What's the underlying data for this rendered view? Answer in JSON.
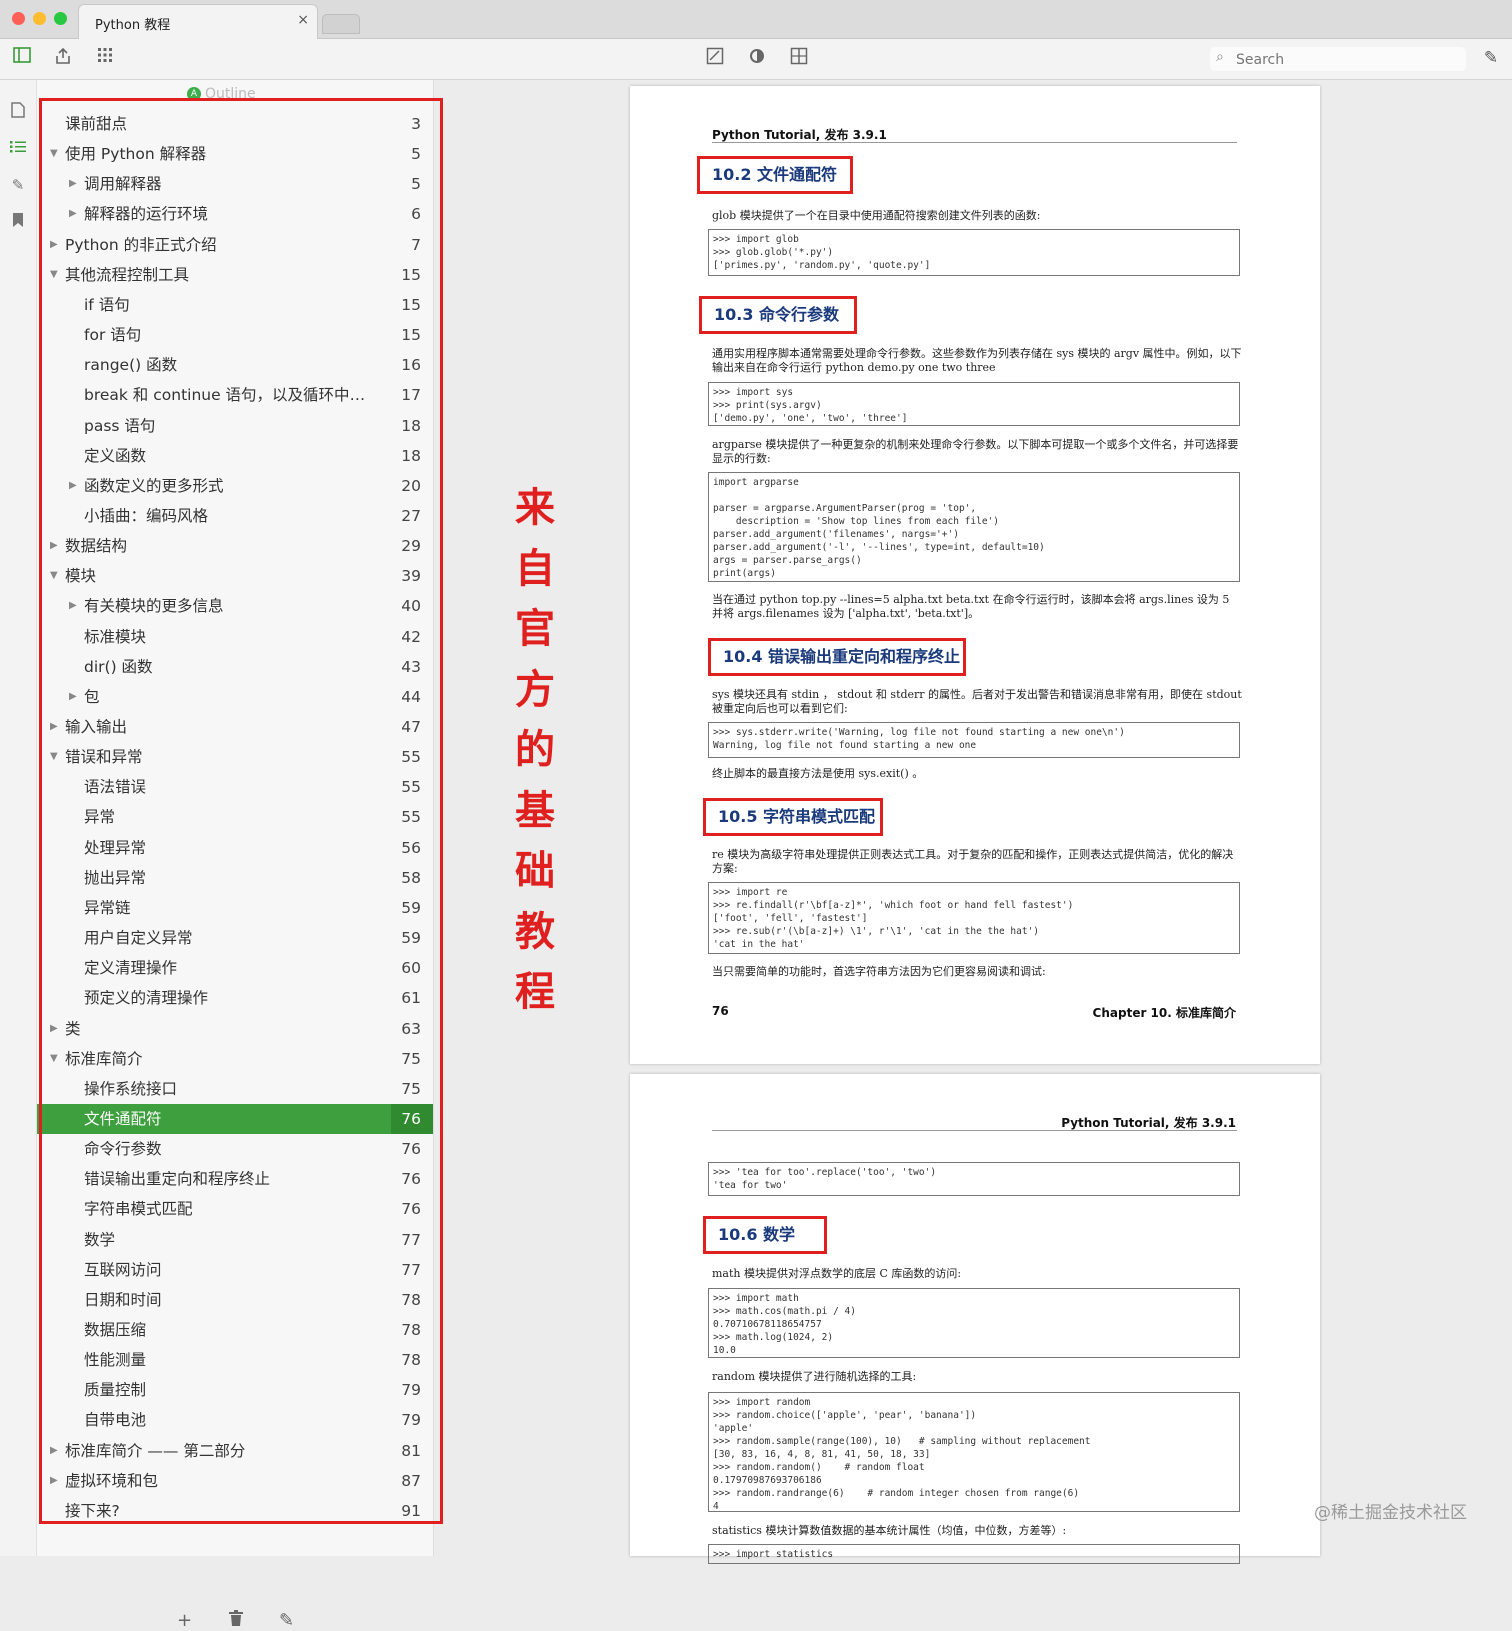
{
  "window": {
    "tab_title": "Python 教程",
    "tab_close": "×",
    "search_placeholder": "Search"
  },
  "toolbar_icons": [
    "sidebar-toggle-icon",
    "share-icon",
    "grid-icon",
    "edit-image-icon",
    "theme-icon",
    "layout-icon",
    "pen-icon"
  ],
  "outline": {
    "header": "Outline",
    "items": [
      {
        "label": "课前甜点",
        "page": "3",
        "level": 0,
        "arrow": ""
      },
      {
        "label": "使用 Python 解释器",
        "page": "5",
        "level": 0,
        "arrow": "▼"
      },
      {
        "label": "调用解释器",
        "page": "5",
        "level": 1,
        "arrow": "▶"
      },
      {
        "label": "解释器的运行环境",
        "page": "6",
        "level": 1,
        "arrow": "▶"
      },
      {
        "label": "Python 的非正式介绍",
        "page": "7",
        "level": 0,
        "arrow": "▶"
      },
      {
        "label": "其他流程控制工具",
        "page": "15",
        "level": 0,
        "arrow": "▼"
      },
      {
        "label": "if 语句",
        "page": "15",
        "level": 1,
        "arrow": ""
      },
      {
        "label": "for 语句",
        "page": "15",
        "level": 1,
        "arrow": ""
      },
      {
        "label": "range() 函数",
        "page": "16",
        "level": 1,
        "arrow": ""
      },
      {
        "label": "break 和 continue 语句，以及循环中的 el...",
        "page": "17",
        "level": 1,
        "arrow": ""
      },
      {
        "label": "pass 语句",
        "page": "18",
        "level": 1,
        "arrow": ""
      },
      {
        "label": "定义函数",
        "page": "18",
        "level": 1,
        "arrow": ""
      },
      {
        "label": "函数定义的更多形式",
        "page": "20",
        "level": 1,
        "arrow": "▶"
      },
      {
        "label": "小插曲：编码风格",
        "page": "27",
        "level": 1,
        "arrow": ""
      },
      {
        "label": "数据结构",
        "page": "29",
        "level": 0,
        "arrow": "▶"
      },
      {
        "label": "模块",
        "page": "39",
        "level": 0,
        "arrow": "▼"
      },
      {
        "label": "有关模块的更多信息",
        "page": "40",
        "level": 1,
        "arrow": "▶"
      },
      {
        "label": "标准模块",
        "page": "42",
        "level": 1,
        "arrow": ""
      },
      {
        "label": "dir() 函数",
        "page": "43",
        "level": 1,
        "arrow": ""
      },
      {
        "label": "包",
        "page": "44",
        "level": 1,
        "arrow": "▶"
      },
      {
        "label": "输入输出",
        "page": "47",
        "level": 0,
        "arrow": "▶"
      },
      {
        "label": "错误和异常",
        "page": "55",
        "level": 0,
        "arrow": "▼"
      },
      {
        "label": "语法错误",
        "page": "55",
        "level": 1,
        "arrow": ""
      },
      {
        "label": "异常",
        "page": "55",
        "level": 1,
        "arrow": ""
      },
      {
        "label": "处理异常",
        "page": "56",
        "level": 1,
        "arrow": ""
      },
      {
        "label": "抛出异常",
        "page": "58",
        "level": 1,
        "arrow": ""
      },
      {
        "label": "异常链",
        "page": "59",
        "level": 1,
        "arrow": ""
      },
      {
        "label": "用户自定义异常",
        "page": "59",
        "level": 1,
        "arrow": ""
      },
      {
        "label": "定义清理操作",
        "page": "60",
        "level": 1,
        "arrow": ""
      },
      {
        "label": "预定义的清理操作",
        "page": "61",
        "level": 1,
        "arrow": ""
      },
      {
        "label": "类",
        "page": "63",
        "level": 0,
        "arrow": "▶"
      },
      {
        "label": "标准库简介",
        "page": "75",
        "level": 0,
        "arrow": "▼"
      },
      {
        "label": "操作系统接口",
        "page": "75",
        "level": 1,
        "arrow": ""
      },
      {
        "label": "文件通配符",
        "page": "76",
        "level": 1,
        "arrow": "",
        "active": true
      },
      {
        "label": "命令行参数",
        "page": "76",
        "level": 1,
        "arrow": ""
      },
      {
        "label": "错误输出重定向和程序终止",
        "page": "76",
        "level": 1,
        "arrow": ""
      },
      {
        "label": "字符串模式匹配",
        "page": "76",
        "level": 1,
        "arrow": ""
      },
      {
        "label": "数学",
        "page": "77",
        "level": 1,
        "arrow": ""
      },
      {
        "label": "互联网访问",
        "page": "77",
        "level": 1,
        "arrow": ""
      },
      {
        "label": "日期和时间",
        "page": "78",
        "level": 1,
        "arrow": ""
      },
      {
        "label": "数据压缩",
        "page": "78",
        "level": 1,
        "arrow": ""
      },
      {
        "label": "性能测量",
        "page": "78",
        "level": 1,
        "arrow": ""
      },
      {
        "label": "质量控制",
        "page": "79",
        "level": 1,
        "arrow": ""
      },
      {
        "label": "自带电池",
        "page": "79",
        "level": 1,
        "arrow": ""
      },
      {
        "label": "标准库简介 —— 第二部分",
        "page": "81",
        "level": 0,
        "arrow": "▶"
      },
      {
        "label": "虚拟环境和包",
        "page": "87",
        "level": 0,
        "arrow": "▶"
      },
      {
        "label": "接下来?",
        "page": "91",
        "level": 0,
        "arrow": ""
      }
    ]
  },
  "annotation": {
    "chars": [
      "来",
      "自",
      "官",
      "方",
      "的",
      "基",
      "础",
      "教",
      "程"
    ]
  },
  "page1": {
    "running_head": "Python Tutorial, 发布 3.9.1",
    "s102": "10.2  文件通配符",
    "s102_text": "glob 模块提供了一个在目录中使用通配符搜索创建文件列表的函数:",
    "s102_code": ">>> import glob\n>>> glob.glob('*.py')\n['primes.py', 'random.py', 'quote.py']",
    "s103": "10.3  命令行参数",
    "s103_text": "通用实用程序脚本通常需要处理命令行参数。这些参数作为列表存储在 sys 模块的 argv 属性中。例如，以下输出来自在命令行运行 python demo.py one two three",
    "s103_code": ">>> import sys\n>>> print(sys.argv)\n['demo.py', 'one', 'two', 'three']",
    "s103_text2": "argparse 模块提供了一种更复杂的机制来处理命令行参数。以下脚本可提取一个或多个文件名，并可选择要显示的行数:",
    "s103_code2": "import argparse\n\nparser = argparse.ArgumentParser(prog = 'top',\n    description = 'Show top lines from each file')\nparser.add_argument('filenames', nargs='+')\nparser.add_argument('-l', '--lines', type=int, default=10)\nargs = parser.parse_args()\nprint(args)",
    "s103_text3": "当在通过 python top.py --lines=5 alpha.txt beta.txt 在命令行运行时，该脚本会将 args.lines 设为 5 并将 args.filenames 设为 ['alpha.txt', 'beta.txt']。",
    "s104": "10.4  错误输出重定向和程序终止",
    "s104_text": "sys 模块还具有 stdin ， stdout 和 stderr 的属性。后者对于发出警告和错误消息非常有用，即使在 stdout 被重定向后也可以看到它们:",
    "s104_code": ">>> sys.stderr.write('Warning, log file not found starting a new one\\n')\nWarning, log file not found starting a new one",
    "s104_text2": "终止脚本的最直接方法是使用 sys.exit() 。",
    "s105": "10.5  字符串模式匹配",
    "s105_text": "re 模块为高级字符串处理提供正则表达式工具。对于复杂的匹配和操作，正则表达式提供简洁，优化的解决方案:",
    "s105_code": ">>> import re\n>>> re.findall(r'\\bf[a-z]*', 'which foot or hand fell fastest')\n['foot', 'fell', 'fastest']\n>>> re.sub(r'(\\b[a-z]+) \\1', r'\\1', 'cat in the the hat')\n'cat in the hat'",
    "s105_text2": "当只需要简单的功能时，首选字符串方法因为它们更容易阅读和调试:",
    "footer_page": "76",
    "footer_chapter": "Chapter 10.  标准库简介"
  },
  "page2": {
    "running_head": "Python Tutorial, 发布 3.9.1",
    "code0": ">>> 'tea for too'.replace('too', 'two')\n'tea for two'",
    "s106": "10.6  数学",
    "s106_text": "math 模块提供对浮点数学的底层 C 库函数的访问:",
    "s106_code": ">>> import math\n>>> math.cos(math.pi / 4)\n0.70710678118654757\n>>> math.log(1024, 2)\n10.0",
    "s106_text2": "random 模块提供了进行随机选择的工具:",
    "s106_code2": ">>> import random\n>>> random.choice(['apple', 'pear', 'banana'])\n'apple'\n>>> random.sample(range(100), 10)   # sampling without replacement\n[30, 83, 16, 4, 8, 81, 41, 50, 18, 33]\n>>> random.random()    # random float\n0.17970987693706186\n>>> random.randrange(6)    # random integer chosen from range(6)\n4",
    "s106_text3": "statistics 模块计算数值数据的基本统计属性（均值，中位数，方差等）:",
    "s106_code3": ">>> import statistics"
  },
  "watermark": "@稀土掘金技术社区"
}
